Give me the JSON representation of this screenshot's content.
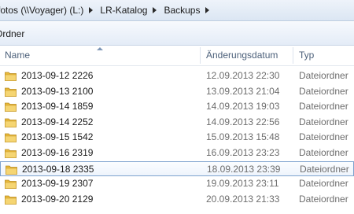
{
  "breadcrumb": {
    "items": [
      "fotos (\\\\Voyager) (L:)",
      "LR-Katalog",
      "Backups"
    ]
  },
  "commandbar": {
    "new_folder_label": "Ordner"
  },
  "columns": {
    "name": "Name",
    "date": "Änderungsdatum",
    "type": "Typ"
  },
  "colors": {
    "folder": "#e8b93a",
    "selection_border": "#7da2ce"
  },
  "rows": [
    {
      "name": "2013-09-12 2226",
      "date": "12.09.2013 22:30",
      "type": "Dateiordner"
    },
    {
      "name": "2013-09-13 2100",
      "date": "13.09.2013 21:04",
      "type": "Dateiordner"
    },
    {
      "name": "2013-09-14 1859",
      "date": "14.09.2013 19:03",
      "type": "Dateiordner"
    },
    {
      "name": "2013-09-14 2252",
      "date": "14.09.2013 22:56",
      "type": "Dateiordner"
    },
    {
      "name": "2013-09-15 1542",
      "date": "15.09.2013 15:48",
      "type": "Dateiordner"
    },
    {
      "name": "2013-09-16 2319",
      "date": "16.09.2013 23:23",
      "type": "Dateiordner"
    },
    {
      "name": "2013-09-18 2335",
      "date": "18.09.2013 23:39",
      "type": "Dateiordner",
      "selected": true
    },
    {
      "name": "2013-09-19 2307",
      "date": "19.09.2013 23:11",
      "type": "Dateiordner"
    },
    {
      "name": "2013-09-20 2129",
      "date": "20.09.2013 21:33",
      "type": "Dateiordner"
    }
  ]
}
